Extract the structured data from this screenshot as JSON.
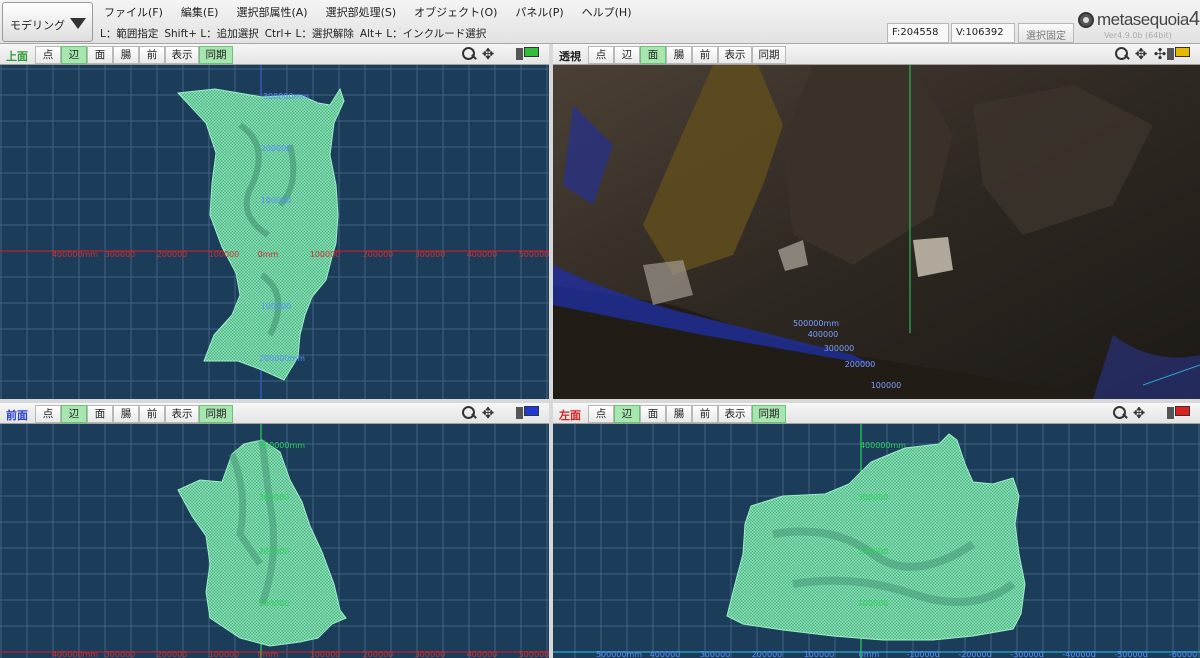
{
  "toolbar": {
    "mode": "モデリング",
    "menu": [
      "ファイル(F)",
      "編集(E)",
      "選択部属性(A)",
      "選択部処理(S)",
      "オブジェクト(O)",
      "パネル(P)",
      "ヘルプ(H)"
    ],
    "hints": [
      "L：範囲指定",
      "Shift+ L：追加選択",
      "Ctrl+ L：選択解除",
      "Alt+ L：インクルード選択"
    ],
    "faces": "F:204558",
    "verts": "V:106392",
    "lock": "選択固定",
    "logo": "metasequoia",
    "logo_num": "4",
    "version": "Ver4.9.0b (64bit)"
  },
  "viewports": {
    "top": {
      "title": "上面",
      "title_color": "#2e9c3a",
      "buttons": [
        {
          "label": "点",
          "active": false
        },
        {
          "label": "辺",
          "active": true
        },
        {
          "label": "面",
          "active": false
        },
        {
          "label": "腸",
          "active": false
        },
        {
          "label": "前",
          "active": false
        },
        {
          "label": "表示",
          "active": false
        },
        {
          "label": "同期",
          "active": true
        }
      ],
      "monitor_color": "#2fbf3c",
      "x_ticks": [
        "400000mm",
        "300000",
        "200000",
        "100000",
        "0mm",
        "100000",
        "200000",
        "300000",
        "400000",
        "500000"
      ],
      "y_ticks": [
        "300000mm",
        "200000",
        "100000",
        "100000",
        "200000mm"
      ]
    },
    "persp": {
      "title": "透視",
      "title_color": "#222222",
      "buttons": [
        {
          "label": "点",
          "active": false
        },
        {
          "label": "辺",
          "active": false
        },
        {
          "label": "面",
          "active": true
        },
        {
          "label": "腸",
          "active": false
        },
        {
          "label": "前",
          "active": false
        },
        {
          "label": "表示",
          "active": false
        },
        {
          "label": "同期",
          "active": false
        }
      ],
      "monitor_color": "#e6b800",
      "depth_ticks": [
        "500000mm",
        "400000",
        "300000",
        "200000",
        "100000"
      ]
    },
    "front": {
      "title": "前面",
      "title_color": "#2a3fc9",
      "buttons": [
        {
          "label": "点",
          "active": false
        },
        {
          "label": "辺",
          "active": true
        },
        {
          "label": "面",
          "active": false
        },
        {
          "label": "腸",
          "active": false
        },
        {
          "label": "前",
          "active": false
        },
        {
          "label": "表示",
          "active": false
        },
        {
          "label": "同期",
          "active": true
        }
      ],
      "monitor_color": "#1f3ad6",
      "x_ticks": [
        "400000mm",
        "300000",
        "200000",
        "100000",
        "0mm",
        "100000",
        "200000",
        "300000",
        "400000",
        "500000"
      ],
      "y_ticks": [
        "400000mm",
        "300000",
        "200000",
        "100000"
      ]
    },
    "left": {
      "title": "左面",
      "title_color": "#d22020",
      "buttons": [
        {
          "label": "点",
          "active": false
        },
        {
          "label": "辺",
          "active": true
        },
        {
          "label": "面",
          "active": false
        },
        {
          "label": "腸",
          "active": false
        },
        {
          "label": "前",
          "active": false
        },
        {
          "label": "表示",
          "active": false
        },
        {
          "label": "同期",
          "active": true
        }
      ],
      "monitor_color": "#e02020",
      "x_ticks": [
        "500000mm",
        "400000",
        "300000",
        "200000",
        "100000",
        "0mm",
        "-100000",
        "-200000",
        "-300000",
        "-400000",
        "-500000",
        "-60000"
      ],
      "y_ticks": [
        "400000mm",
        "300000",
        "200000",
        "100000"
      ]
    }
  }
}
